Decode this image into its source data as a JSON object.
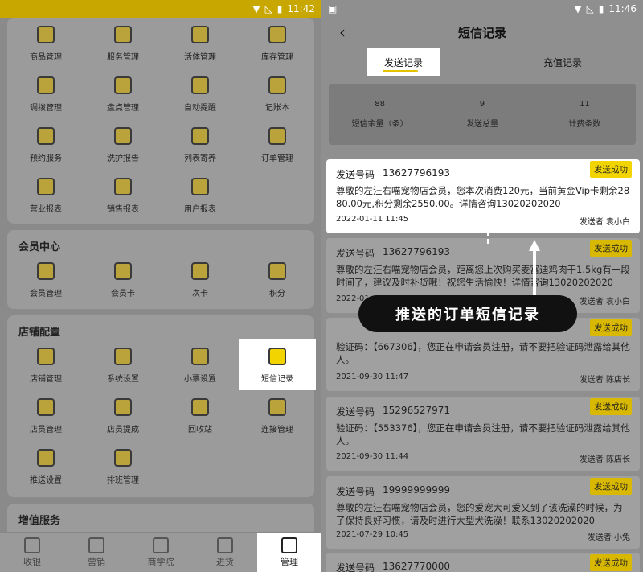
{
  "left": {
    "status_time": "11:42",
    "grid1": [
      {
        "label": "商品管理",
        "icon": "goods-icon"
      },
      {
        "label": "服务管理",
        "icon": "service-icon"
      },
      {
        "label": "活体管理",
        "icon": "pet-icon"
      },
      {
        "label": "库存管理",
        "icon": "inventory-icon"
      },
      {
        "label": "调拨管理",
        "icon": "transfer-icon"
      },
      {
        "label": "盘点管理",
        "icon": "stocktake-icon"
      },
      {
        "label": "自动提醒",
        "icon": "reminder-icon"
      },
      {
        "label": "记账本",
        "icon": "ledger-icon"
      },
      {
        "label": "预约服务",
        "icon": "appointment-icon"
      },
      {
        "label": "洗护报告",
        "icon": "grooming-report-icon"
      },
      {
        "label": "列表寄养",
        "icon": "boarding-icon"
      },
      {
        "label": "订单管理",
        "icon": "order-icon"
      },
      {
        "label": "营业报表",
        "icon": "business-report-icon"
      },
      {
        "label": "销售报表",
        "icon": "sales-report-icon"
      },
      {
        "label": "用户报表",
        "icon": "user-report-icon"
      }
    ],
    "member_title": "会员中心",
    "member_items": [
      {
        "label": "会员管理",
        "icon": "member-icon"
      },
      {
        "label": "会员卡",
        "icon": "member-card-icon"
      },
      {
        "label": "次卡",
        "icon": "count-card-icon"
      },
      {
        "label": "积分",
        "icon": "points-icon"
      }
    ],
    "shop_title": "店铺配置",
    "shop_items": [
      {
        "label": "店铺管理",
        "icon": "shop-icon"
      },
      {
        "label": "系统设置",
        "icon": "gear-icon"
      },
      {
        "label": "小票设置",
        "icon": "receipt-icon"
      },
      {
        "label": "短信记录",
        "icon": "sms-icon"
      },
      {
        "label": "店员管理",
        "icon": "staff-icon"
      },
      {
        "label": "店员提成",
        "icon": "commission-icon"
      },
      {
        "label": "回收站",
        "icon": "trash-icon"
      },
      {
        "label": "连接管理",
        "icon": "bluetooth-icon"
      },
      {
        "label": "推送设置",
        "icon": "push-icon"
      },
      {
        "label": "排班管理",
        "icon": "schedule-icon"
      }
    ],
    "value_title": "增值服务",
    "tabs": [
      {
        "label": "收银",
        "icon": "cashier-icon"
      },
      {
        "label": "营销",
        "icon": "marketing-icon"
      },
      {
        "label": "商学院",
        "icon": "academy-icon"
      },
      {
        "label": "进货",
        "icon": "purchase-icon"
      },
      {
        "label": "管理",
        "icon": "manage-icon"
      }
    ]
  },
  "right": {
    "status_time": "11:46",
    "title": "短信记录",
    "tab_send": "发送记录",
    "tab_recharge": "充值记录",
    "stats": [
      {
        "value": "88",
        "label": "短信余量（条）"
      },
      {
        "value": "9",
        "label": "发送总量"
      },
      {
        "value": "11",
        "label": "计费条数"
      }
    ],
    "messages": [
      {
        "head": "发送号码",
        "phone": "13627796193",
        "body": "尊敬的左汪右喵宠物店会员，您本次消费120元，当前黄金Vip卡剩余2880.00元,积分剩余2550.00。详情咨询13020202020",
        "date": "2022-01-11 11:45",
        "sender": "发送者  袁小白",
        "status": "发送成功"
      },
      {
        "head": "发送号码",
        "phone": "13627796193",
        "body": "尊敬的左汪右喵宠物店会员，距离您上次购买麦富迪鸡肉干1.5kg有一段时间了，建议及时补货哦！祝您生活愉快！详情咨询13020202020",
        "date": "2022-01-08",
        "sender": "发送者  袁小白",
        "status": "发送成功"
      },
      {
        "head": "验证码：【667306】，您正在申请会员注册，请不要把验证码泄露给其他人。",
        "phone": "",
        "body": "",
        "date": "2021-09-30 11:47",
        "sender": "发送者  陈店长",
        "status": "发送成功"
      },
      {
        "head": "发送号码",
        "phone": "15296527971",
        "body": "验证码：【553376】，您正在申请会员注册，请不要把验证码泄露给其他人。",
        "date": "2021-09-30 11:44",
        "sender": "发送者  陈店长",
        "status": "发送成功"
      },
      {
        "head": "发送号码",
        "phone": "19999999999",
        "body": "尊敬的左汪右喵宠物店会员，您的爱宠大可爱又到了该洗澡的时候，为了保持良好习惯，请及时进行大型犬洗澡！联系13020202020",
        "date": "2021-07-29 10:45",
        "sender": "发送者  小兔",
        "status": "发送成功"
      },
      {
        "head": "发送号码",
        "phone": "13627770000",
        "body": "",
        "date": "",
        "sender": "",
        "status": "发送成功"
      }
    ],
    "callout": "推送的订单短信记录"
  }
}
